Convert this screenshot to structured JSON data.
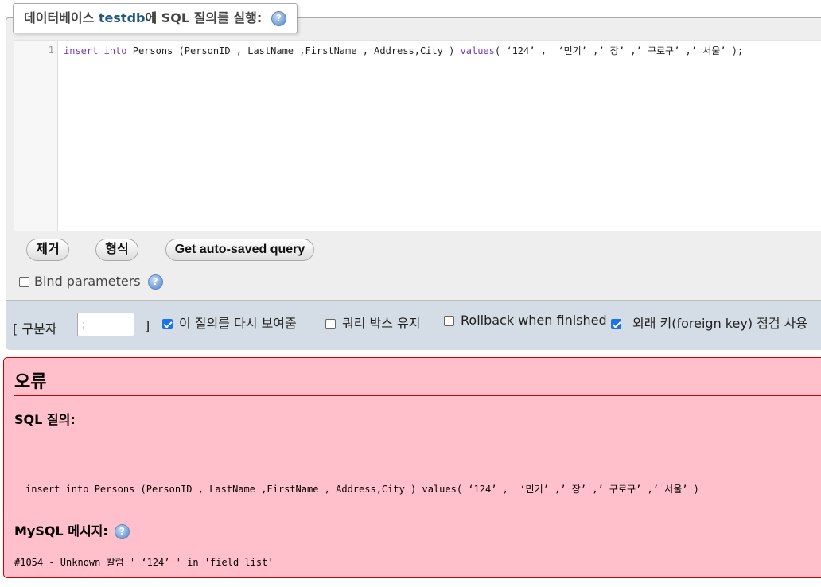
{
  "query_box": {
    "legend_prefix": "데이터베이스 ",
    "db_name": "testdb",
    "legend_suffix": "에 SQL 질의를 실행:",
    "help_glyph": "?",
    "line_number": "1",
    "code": {
      "kw_insert": "insert",
      "kw_into": "into",
      "part1": " Persons (PersonID , LastName ,FirstName , Address,City ) ",
      "fn_values": "values",
      "part2": "( ‘124’ ,  ‘민기’ ,’ 장’ ,’ 구로구’ ,’ 서울’ );"
    }
  },
  "buttons": {
    "clear": "제거",
    "format": "형식",
    "autosave": "Get auto-saved query"
  },
  "bind_parameters": {
    "label": "Bind parameters",
    "checked": false
  },
  "options": {
    "delimiter_label": "[ 구분자",
    "delimiter_value": ";",
    "delimiter_close": "]",
    "show_query_again": {
      "label": "이 질의를 다시 보여줌",
      "checked": true
    },
    "retain_query_box": {
      "label": "쿼리 박스 유지",
      "checked": false
    },
    "rollback": {
      "label": "Rollback when finished",
      "checked": false
    },
    "foreign_key": {
      "label": "외래 키(foreign key) 점검 사용",
      "checked": true
    }
  },
  "error": {
    "title": "오류",
    "sql_query_label": "SQL 질의:",
    "sql_text": "insert into Persons (PersonID , LastName ,FirstName , Address,City ) values( ‘124’ ,  ‘민기’ ,’ 장’ ,’ 구로구’ ,’ 서울’ )",
    "mysql_label": "MySQL 메시지:",
    "message": "#1054 - Unknown 칼럼 ' ‘124’ ' in 'field list'"
  },
  "colors": {
    "error_bg": "#ffc0cb",
    "error_border": "#cc0000",
    "options_bg": "#d4dde5",
    "checkbox_on": "#1a73e8",
    "db_name": "#235a81"
  }
}
